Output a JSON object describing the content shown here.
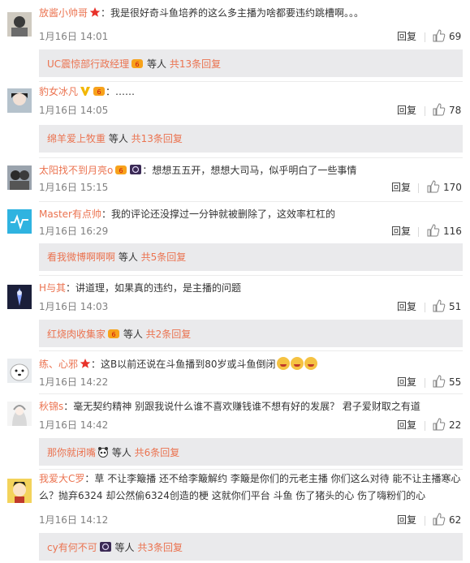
{
  "comments": [
    {
      "user": "放酱小帅哥",
      "text": "：我是很好奇斗鱼培养的这么多主播为啥都要违约跳槽啊。。。",
      "time": "1月16日 14:01",
      "reply_label": "回复",
      "likes": "69",
      "sub": {
        "user": "UC震惊部行政经理",
        "mid": " 等人 ",
        "total": "共13条回复"
      }
    },
    {
      "user": "豹女冰凡",
      "text": "：……",
      "time": "1月16日 14:05",
      "reply_label": "回复",
      "likes": "78",
      "sub": {
        "user": "绵羊爱上牧重",
        "mid": " 等人 ",
        "total": "共13条回复"
      }
    },
    {
      "user": "太阳找不到月亮o",
      "text": "：想想五五开，想想大司马，似乎明白了一些事情",
      "time": "1月16日 15:15",
      "reply_label": "回复",
      "likes": "170"
    },
    {
      "user": "Master有点帅",
      "text": "：我的评论还没撑过一分钟就被删除了，这效率杠杠的",
      "time": "1月16日 16:29",
      "reply_label": "回复",
      "likes": "116",
      "sub": {
        "user": "看我微博啊啊啊",
        "mid": " 等人 ",
        "total": "共5条回复"
      }
    },
    {
      "user": "H与其",
      "text": "：讲道理，如果真的违约，是主播的问题",
      "time": "1月16日 14:03",
      "reply_label": "回复",
      "likes": "51",
      "sub": {
        "user": "红烧肉收集家",
        "mid": " 等人 ",
        "total": "共2条回复"
      }
    },
    {
      "user": "练、心邪",
      "text": "：这B以前还说在斗鱼播到80岁或斗鱼倒闭",
      "time": "1月16日 14:22",
      "reply_label": "回复",
      "likes": "55"
    },
    {
      "user": "秋锦s",
      "text": "：毫无契约精神 别跟我说什么谁不喜欢赚钱谁不想有好的发展？ 君子爱财取之有道",
      "time": "1月16日 14:42",
      "reply_label": "回复",
      "likes": "22",
      "sub": {
        "user": "那你就闭嘴",
        "mid": " 等人 ",
        "total": "共6条回复"
      }
    },
    {
      "user": "我爱大C罗",
      "text": "：草 不让李簸播 还不给李簸解约 李簸是你们的元老主播 你们这么对待 能不让主播寒心么？抛弃6324 却公然偷6324创造的梗 这就你们平台 斗鱼 伤了猪头的心 伤了嗨粉们的心",
      "time": "1月16日 14:12",
      "reply_label": "回复",
      "likes": "62",
      "sub": {
        "user": "cy有何不可",
        "mid": " 等人 ",
        "total": "共3条回复"
      }
    }
  ],
  "colors": {
    "username": "#eb7350",
    "text": "#333333",
    "time": "#808080",
    "subbox_bg": "#eaeaec"
  },
  "icons": [
    "thumbs-up-icon",
    "vip-crown-icon",
    "red-star-icon",
    "gold-v-icon",
    "emoji-icon"
  ]
}
